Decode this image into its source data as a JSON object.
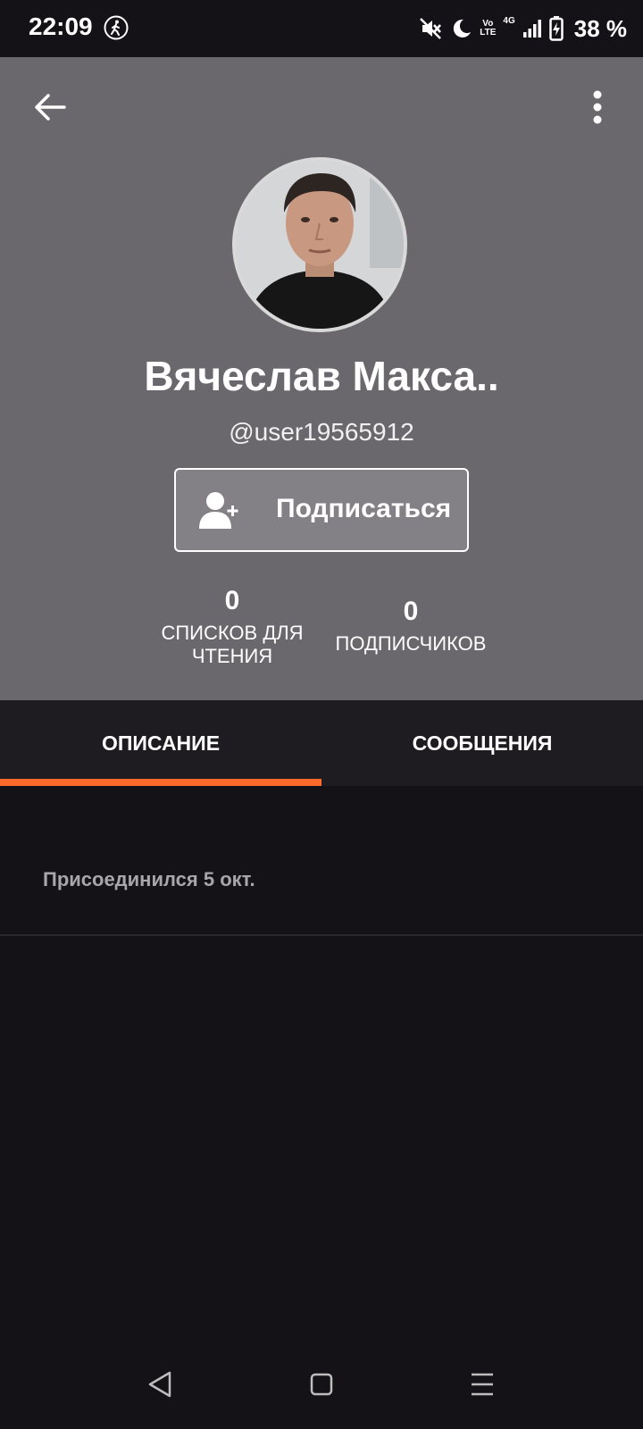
{
  "status_bar": {
    "time": "22:09",
    "network": "4G",
    "volte_top": "Vo",
    "volte_bottom": "LTE",
    "battery": "38 %"
  },
  "header": {
    "back_icon": "arrow-left-icon",
    "more_icon": "more-vertical-icon",
    "background_color": "#6a686c"
  },
  "profile": {
    "name": "Вячеслав Макса..",
    "username": "@user19565912",
    "follow_button_label": "Подписаться",
    "stats": {
      "reading_lists_value": "0",
      "reading_lists_label_line1": "СПИСКОВ ДЛЯ",
      "reading_lists_label_line2": "ЧТЕНИЯ",
      "followers_value": "0",
      "followers_label": "ПОДПИСЧИКОВ"
    }
  },
  "tabs": [
    {
      "label": "ОПИСАНИЕ",
      "active": true
    },
    {
      "label": "СООБЩЕНИЯ",
      "active": false
    }
  ],
  "accent_color": "#ff6a2b",
  "description": {
    "joined_text": "Присоединился 5 окт."
  },
  "nav_bar": {
    "back_icon": "triangle-back-icon",
    "home_icon": "square-home-icon",
    "menu_icon": "hamburger-menu-icon"
  }
}
